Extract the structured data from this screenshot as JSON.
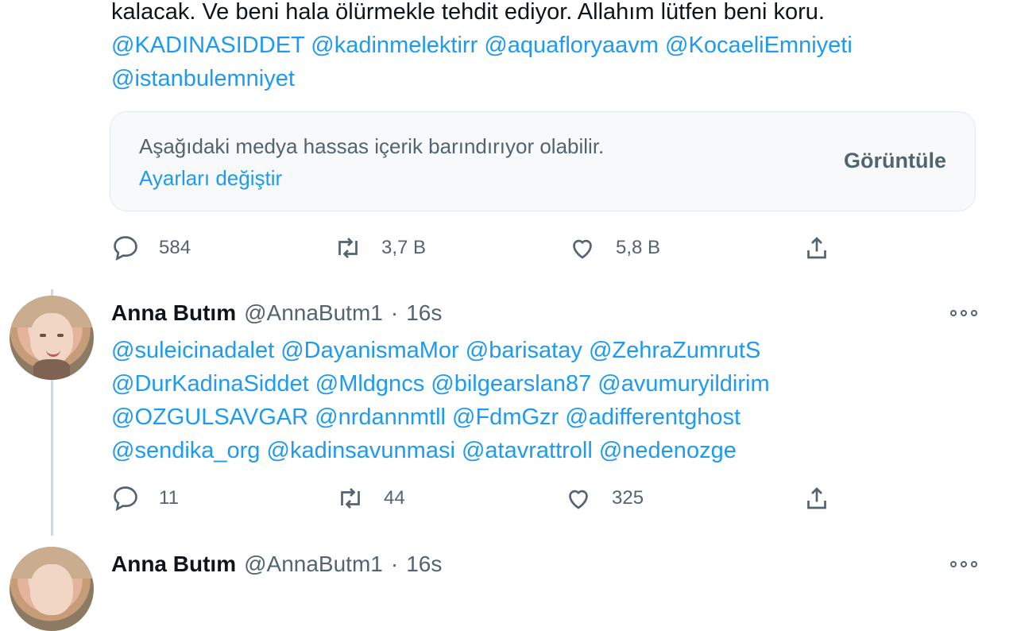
{
  "top_tweet": {
    "text_line": "kalacak. Ve beni hala ölürmekle tehdit ediyor. Allahım lütfen beni koru.",
    "mentions_line1": [
      "@KADINASIDDET",
      "@kadinmelektirr",
      "@aquafloryaavm",
      "@KocaeliEmniyeti"
    ],
    "mentions_line2": [
      "@istanbulemniyet"
    ],
    "sensitive_notice": {
      "message": "Aşağıdaki medya hassas içerik barındırıyor olabilir.",
      "settings_link": "Ayarları değiştir",
      "view_button": "Görüntüle"
    },
    "actions": {
      "replies": "584",
      "retweets": "3,7 B",
      "likes": "5,8 B"
    }
  },
  "reply_tweet": {
    "name": "Anna Butım",
    "handle": "@AnnaButm1",
    "separator": "·",
    "time": "16s",
    "mention_lines": [
      [
        "@suleicinadalet",
        "@DayanismaMor",
        "@barisatay",
        "@ZehraZumrutS"
      ],
      [
        "@DurKadinaSiddet",
        "@Mldgncs",
        "@bilgearslan87",
        "@avumuryildirim"
      ],
      [
        "@OZGULSAVGAR",
        "@nrdannmtll",
        "@FdmGzr",
        "@adifferentghost"
      ],
      [
        "@sendika_org",
        "@kadinsavunmasi",
        "@atavrattroll",
        "@nedenozge"
      ]
    ],
    "actions": {
      "replies": "11",
      "retweets": "44",
      "likes": "325"
    }
  },
  "next_tweet": {
    "name": "Anna Butım",
    "handle": "@AnnaButm1",
    "separator": "·",
    "time": "16s"
  },
  "icons": [
    "reply-icon",
    "retweet-icon",
    "like-icon",
    "share-icon",
    "more-icon"
  ],
  "colors": {
    "link": "#1d9bf0",
    "muted": "#536471",
    "text": "#0f1419"
  }
}
